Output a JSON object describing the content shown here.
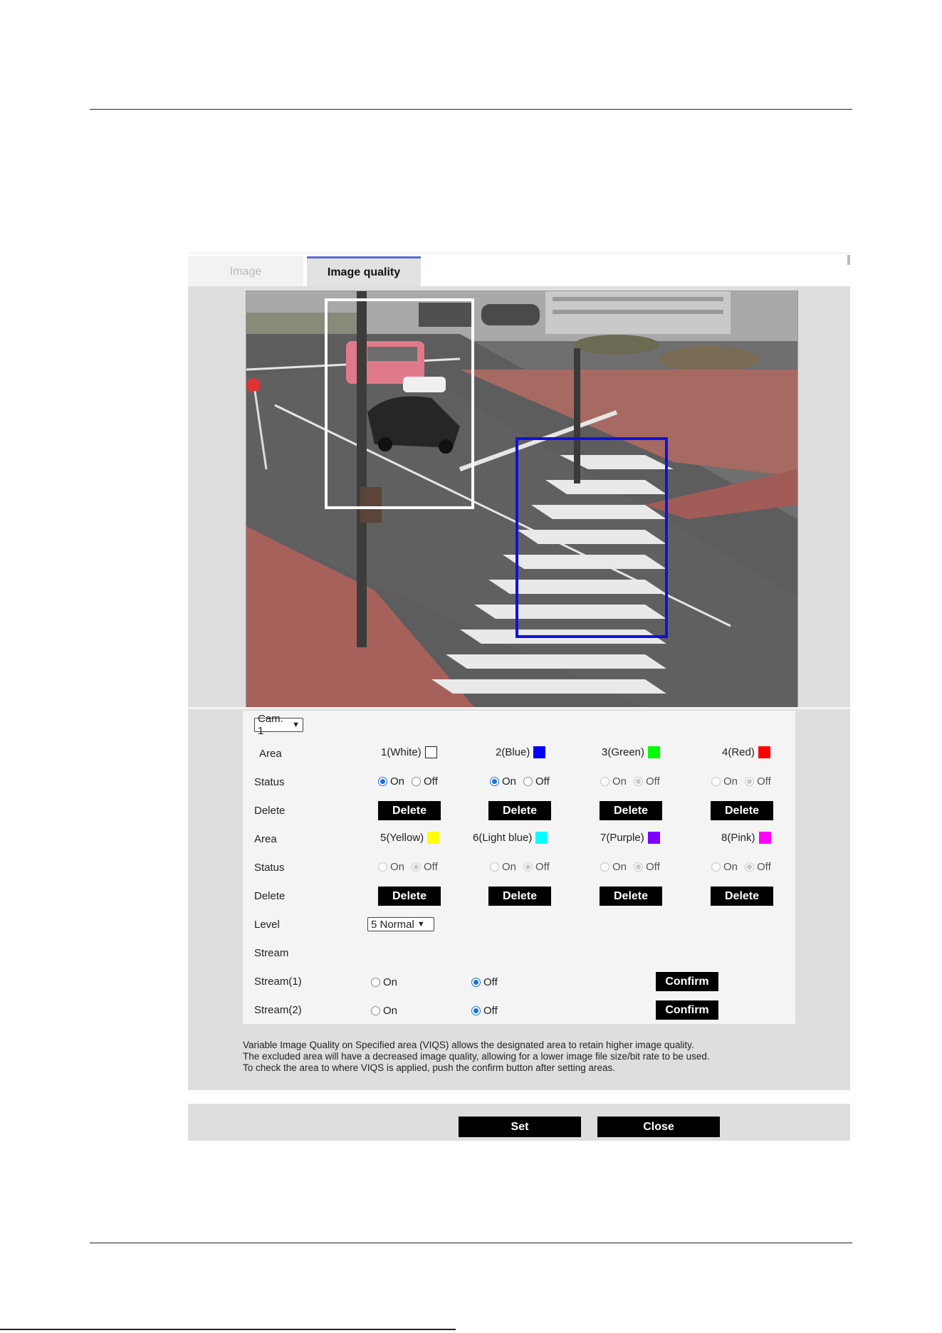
{
  "tabs": [
    {
      "label": "Image",
      "active": false
    },
    {
      "label": "Image quality",
      "active": true
    }
  ],
  "camera_select": {
    "value": "Cam. 1"
  },
  "row_labels": {
    "area": "Area",
    "status": "Status",
    "delete": "Delete",
    "level": "Level",
    "stream": "Stream",
    "stream1": "Stream(1)",
    "stream2": "Stream(2)"
  },
  "areas": [
    {
      "label": "1(White)",
      "color": "#ffffff",
      "status": "On",
      "enabled": true
    },
    {
      "label": "2(Blue)",
      "color": "#0000ff",
      "status": "On",
      "enabled": true
    },
    {
      "label": "3(Green)",
      "color": "#00ff00",
      "status": "Off",
      "enabled": false
    },
    {
      "label": "4(Red)",
      "color": "#ff0000",
      "status": "Off",
      "enabled": false
    },
    {
      "label": "5(Yellow)",
      "color": "#ffff00",
      "status": "Off",
      "enabled": false
    },
    {
      "label": "6(Light blue)",
      "color": "#00ffff",
      "status": "Off",
      "enabled": false
    },
    {
      "label": "7(Purple)",
      "color": "#8000ff",
      "status": "Off",
      "enabled": false
    },
    {
      "label": "8(Pink)",
      "color": "#ff00ff",
      "status": "Off",
      "enabled": false
    }
  ],
  "radio_labels": {
    "on": "On",
    "off": "Off"
  },
  "delete_label": "Delete",
  "level_select": {
    "value": "5 Normal"
  },
  "streams": [
    {
      "name": "Stream(1)",
      "value": "Off"
    },
    {
      "name": "Stream(2)",
      "value": "Off"
    }
  ],
  "confirm_label": "Confirm",
  "help_text": [
    "Variable Image Quality on Specified area (VIQS) allows the designated area to retain higher image quality.",
    "The excluded area will have a decreased image quality, allowing for a lower image file size/bit rate to be used.",
    "To check the area to where VIQS is applied, push the confirm button after setting areas."
  ],
  "buttons": {
    "set": "Set",
    "close": "Close"
  }
}
